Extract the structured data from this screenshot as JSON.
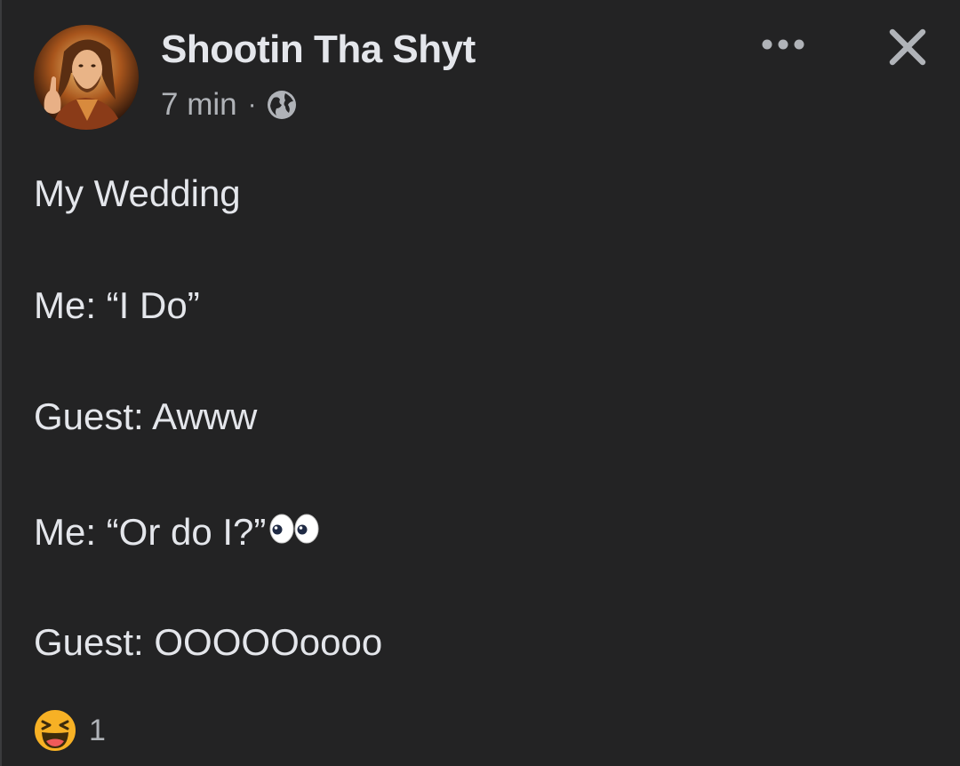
{
  "post": {
    "author": "Shootin Tha Shyt",
    "timestamp": "7 min",
    "separator": "·",
    "privacy_icon": "globe-icon",
    "lines": [
      "My Wedding",
      "Me: “I Do”",
      "Guest: Awww",
      "Me: “Or do I?”",
      "Guest: OOOOOoooo"
    ],
    "eyes_emoji": "👀",
    "reaction": {
      "icon": "haha-reaction-icon",
      "count": "1"
    }
  },
  "header_actions": {
    "more_icon": "more-options-icon",
    "close_icon": "close-icon"
  },
  "colors": {
    "background": "#232324",
    "primary_text": "#e4e6eb",
    "secondary_text": "#b0b3b8",
    "haha_yellow": "#f7b125"
  }
}
